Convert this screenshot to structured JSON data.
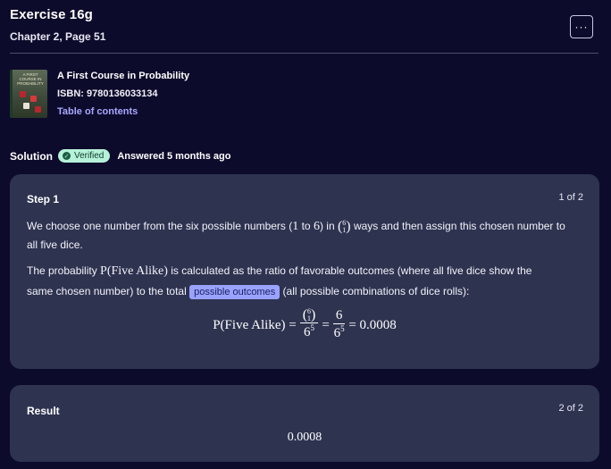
{
  "header": {
    "title": "Exercise 16g",
    "subtitle": "Chapter 2, Page 51",
    "more_label": "···"
  },
  "book": {
    "cover_text": "A FIRST COURSE IN PROBABILITY",
    "title": "A First Course in Probability",
    "isbn": "ISBN: 9780136033134",
    "toc_label": "Table of contents"
  },
  "solution": {
    "label": "Solution",
    "badge": "Verified",
    "answered": "Answered 5 months ago"
  },
  "steps": [
    {
      "label": "Step 1",
      "count": "1 of 2",
      "p1_a": "We choose one number from the six possible numbers (",
      "p1_one": "1",
      "p1_to": " to ",
      "p1_six": "6",
      "p1_b": ") in ",
      "p1_c": " ways and then assign this chosen number to",
      "p1_d": "all five dice.",
      "p2_a": "The probability ",
      "p2_math": "P(Five Alike)",
      "p2_b": " is calculated as the ratio of favorable outcomes (where all five dice show the",
      "p2_c": "same chosen number) to the total ",
      "p2_highlight": "possible outcomes",
      "p2_d": " (all possible combinations of dice rolls):",
      "binom_top": "6",
      "binom_bottom": "1",
      "formula_lhs": "P(Five Alike) =",
      "formula_eq": "=",
      "formula_num2": "6",
      "formula_den_base": "6",
      "formula_den_exp": "5",
      "formula_result": "= 0.0008"
    },
    {
      "label": "Result",
      "count": "2 of 2",
      "value": "0.0008"
    }
  ]
}
